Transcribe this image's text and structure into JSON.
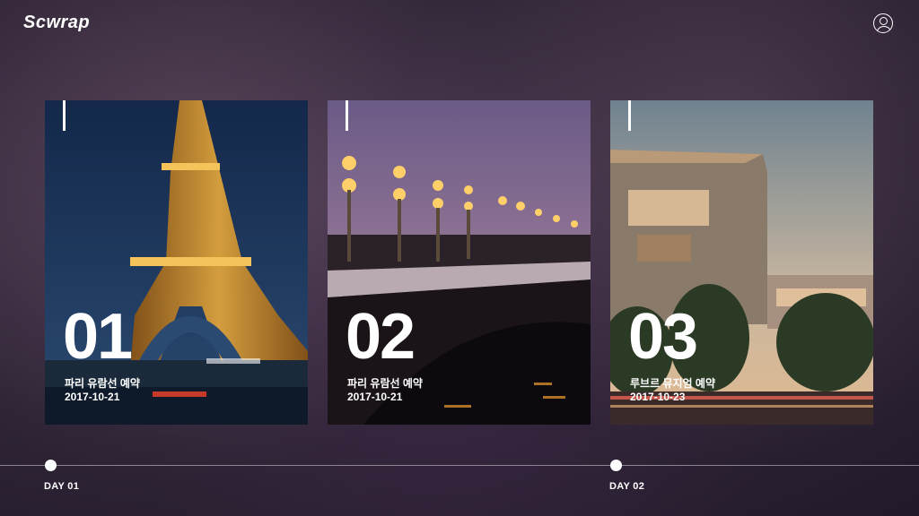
{
  "app": {
    "logo": "Scwrap"
  },
  "cards": [
    {
      "number": "01",
      "title": "파리 유람선 예약",
      "date": "2017-10-21",
      "image": "eiffel-tower-night"
    },
    {
      "number": "02",
      "title": "파리 유람선 예약",
      "date": "2017-10-21",
      "image": "bridge-lamps-dusk"
    },
    {
      "number": "03",
      "title": "루브르 뮤지엄 예약",
      "date": "2017-10-23",
      "image": "modern-building-sunset"
    }
  ],
  "timeline": {
    "days": [
      {
        "label": "DAY 01"
      },
      {
        "label": "DAY 02"
      }
    ]
  },
  "icons": {
    "profile": "user-circle-icon"
  }
}
